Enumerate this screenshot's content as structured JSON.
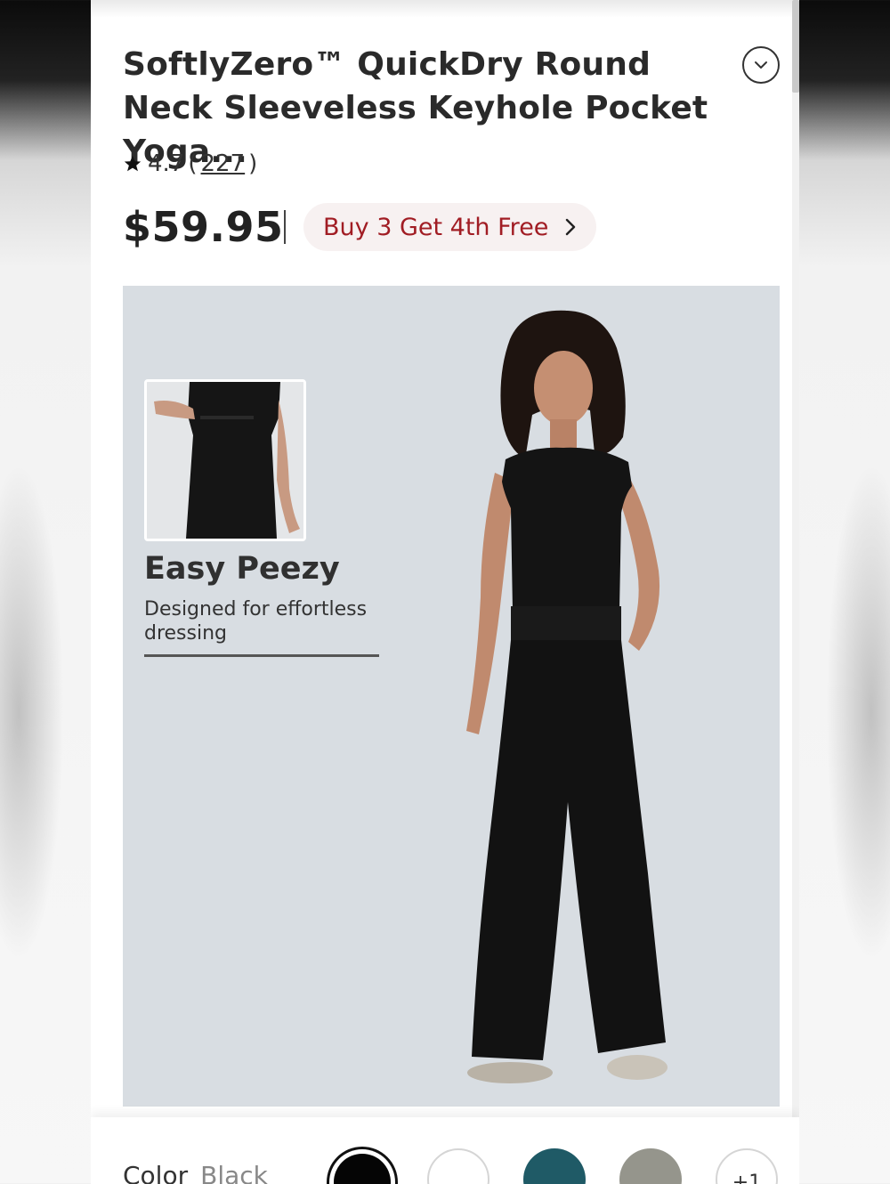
{
  "product": {
    "title": "SoftlyZero™ QuickDry Round Neck Sleeveless Keyhole Pocket Yoga...",
    "rating": "4.7",
    "review_count": "227",
    "price": "$59.95",
    "promo_label": "Buy 3 Get 4th Free"
  },
  "hero": {
    "feature_title": "Easy Peezy",
    "feature_subtitle": "Designed for effortless dressing"
  },
  "color_selector": {
    "label": "Color",
    "selected": "Black",
    "swatches": [
      {
        "name": "Black",
        "hex": "#050505"
      },
      {
        "name": "White",
        "hex": "#ffffff"
      },
      {
        "name": "Teal",
        "hex": "#1f5a66"
      },
      {
        "name": "Grey",
        "hex": "#95958c"
      }
    ],
    "more_label": "+1"
  },
  "colors": {
    "promo_text": "#a11d24",
    "promo_bg": "#f7f1f1",
    "hero_bg": "#d8dde2"
  },
  "icons": {
    "expand": "chevron-down-circle-icon",
    "rating": "star-icon",
    "promo": "chevron-right-icon"
  }
}
